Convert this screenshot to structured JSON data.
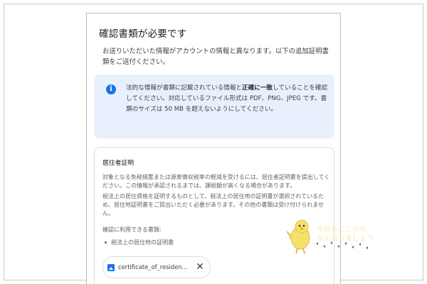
{
  "dialog": {
    "title": "確認書類が必要です",
    "intro": "お送りいただいた情報がアカウントの情報と異なります。以下の追加証明書類をご送付ください。"
  },
  "info": {
    "icon": "info-icon",
    "text_before": "法的な情報が書類に記載されている情報と",
    "text_bold": "正確に一致",
    "text_after": "していることを確認してください。対応しているファイル形式は PDF、PNG、JPEG です。書類のサイズは 50 MB を超えないようにしてください。"
  },
  "card": {
    "title": "居住者証明",
    "p1": "対象となる免税措置または源泉徴収税率の軽減を受けるには、居住者証明書を提出してください。この情報が承認されるまでは、課税額が高くなる場合があります。",
    "p2": "税法上の居住資格を証明するものとして、税法上の居住地の証明書が選択されているため、居住地証明書をご提出いただく必要があります。その他の書類は受け付けられません。",
    "p3": "確認に利用できる書類:",
    "bullet": "税法上の居住地の証明書"
  },
  "attachment": {
    "file_name": "certificate_of_residen...",
    "icon": "image-file-icon",
    "remove_icon": "close-icon"
  },
  "watermark": {
    "line1": "今日もここから",
    "line2": "がんばりましょう"
  },
  "colors": {
    "accent": "#1a73e8",
    "info_bg": "#e8f0fe",
    "mascot": "#f7e06a"
  }
}
